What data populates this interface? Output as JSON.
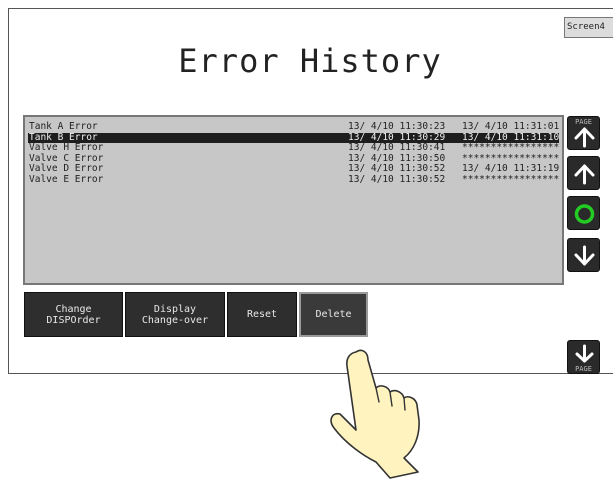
{
  "screen_tag": "Screen4",
  "title": "Error History",
  "list": {
    "rows": [
      {
        "name": "Tank A Error",
        "occurred": "13/ 4/10 11:30:23",
        "recovered": "13/ 4/10 11:31:01",
        "selected": false
      },
      {
        "name": "Tank B Error",
        "occurred": "13/ 4/10 11:30:29",
        "recovered": "13/ 4/10 11:31:10",
        "selected": true
      },
      {
        "name": "Valve H Error",
        "occurred": "13/ 4/10 11:30:41",
        "recovered": "*****************",
        "selected": false
      },
      {
        "name": "Valve C Error",
        "occurred": "13/ 4/10 11:30:50",
        "recovered": "*****************",
        "selected": false
      },
      {
        "name": "Valve D Error",
        "occurred": "13/ 4/10 11:30:52",
        "recovered": "13/ 4/10 11:31:19",
        "selected": false
      },
      {
        "name": "Valve E Error",
        "occurred": "13/ 4/10 11:30:52",
        "recovered": "*****************",
        "selected": false
      }
    ]
  },
  "side_buttons": {
    "page_up_label": "PAGE",
    "page_down_label": "PAGE"
  },
  "bottom_buttons": {
    "change_line1": "Change",
    "change_line2": "DISPOrder",
    "display_line1": "Display",
    "display_line2": "Change-over",
    "reset": "Reset",
    "delete": "Delete"
  },
  "colors": {
    "list_bg": "#c7c7c7",
    "button_bg": "#2a2a2a",
    "arrow": "#ffffff",
    "ok_ring": "#22cc22",
    "hand_fill": "#fff4c0"
  },
  "icons": [
    "page-up-icon",
    "arrow-up-icon",
    "confirm-circle-icon",
    "arrow-down-icon",
    "page-down-icon",
    "pointing-hand-icon"
  ]
}
